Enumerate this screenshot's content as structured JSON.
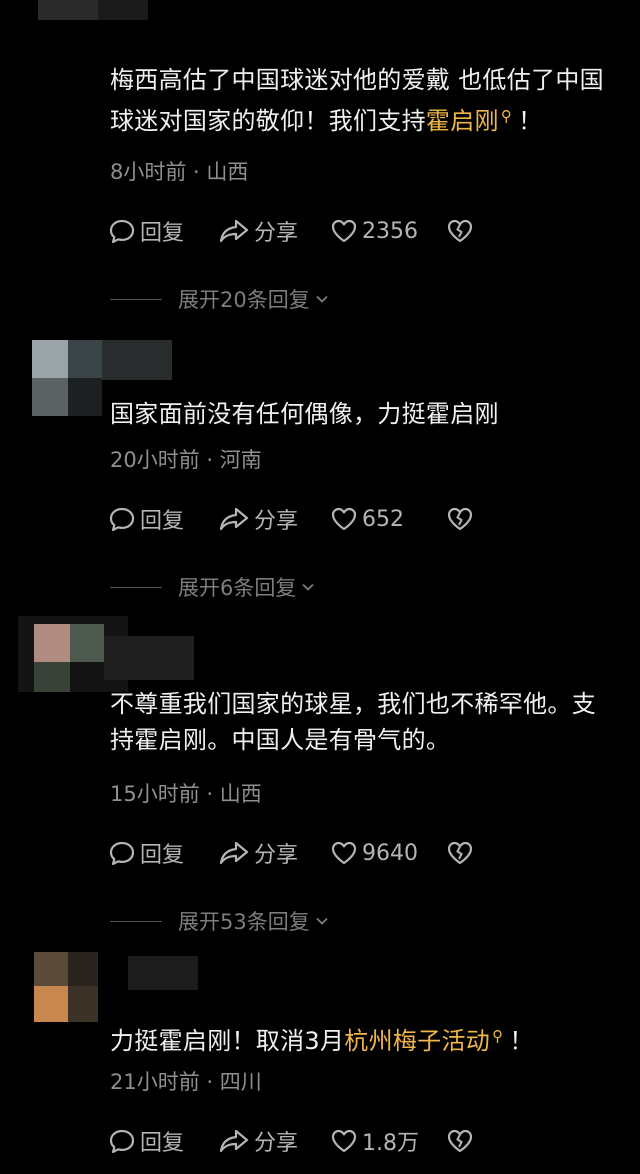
{
  "comments": [
    {
      "text_parts": [
        "梅西高估了中国球迷对他的爱戴 也低估了中国球迷对国家的敬仰！我们支持",
        "霍启刚",
        "！"
      ],
      "time": "8小时前 · 山西",
      "reply_label": "回复",
      "share_label": "分享",
      "likes": "2356",
      "expand_label": "展开20条回复"
    },
    {
      "text_parts": [
        "国家面前没有任何偶像，力挺霍启刚"
      ],
      "time": "20小时前 · 河南",
      "reply_label": "回复",
      "share_label": "分享",
      "likes": "652",
      "expand_label": "展开6条回复"
    },
    {
      "text_parts": [
        "不尊重我们国家的球星，我们也不稀罕他。支持霍启刚。中国人是有骨气的。"
      ],
      "time": "15小时前 · 山西",
      "reply_label": "回复",
      "share_label": "分享",
      "likes": "9640",
      "expand_label": "展开53条回复"
    },
    {
      "text_parts": [
        "力挺霍启刚！取消3月",
        "杭州梅子活动",
        "！"
      ],
      "time": "21小时前 · 四川",
      "reply_label": "回复",
      "share_label": "分享",
      "likes": "1.8万",
      "expand_label": ""
    }
  ],
  "colors": {
    "background": "#000000",
    "text": "#f0f0f0",
    "highlight": "#f0b64a",
    "meta": "#8f8f8f",
    "actions": "#b5b5b5"
  },
  "icons": [
    "comment-bubble-icon",
    "share-arrow-icon",
    "heart-icon",
    "broken-heart-icon",
    "chevron-down-icon",
    "search-icon"
  ]
}
